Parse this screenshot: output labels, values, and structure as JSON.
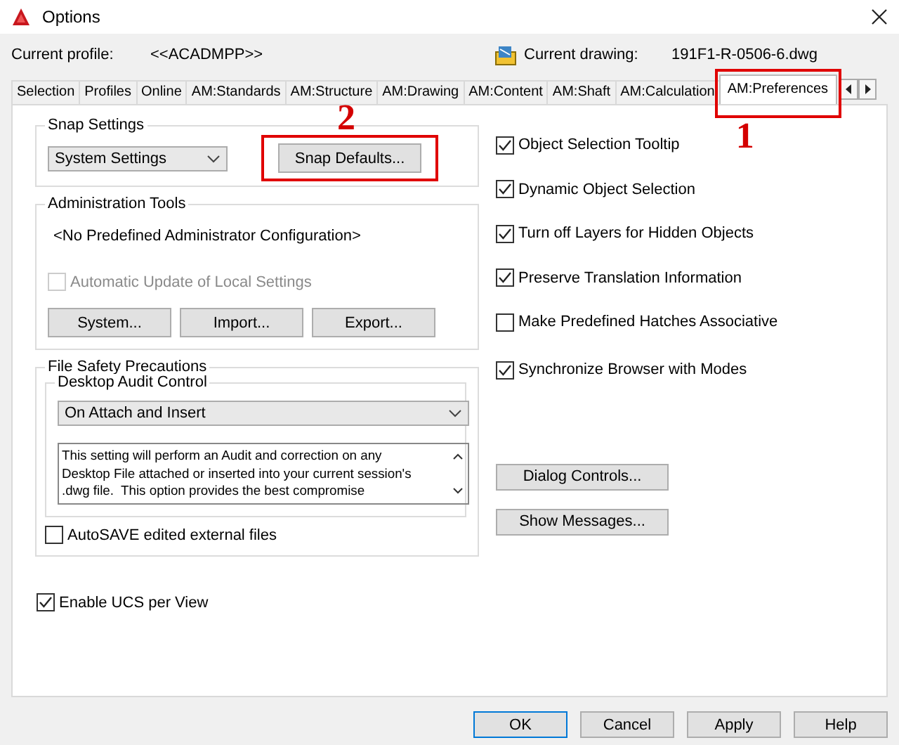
{
  "window": {
    "title": "Options"
  },
  "profile": {
    "label": "Current profile:",
    "value": "<<ACADMPP>>"
  },
  "drawing": {
    "label": "Current drawing:",
    "value": "191F1-R-0506-6.dwg"
  },
  "tabs": [
    {
      "label": "Selection",
      "selected": false
    },
    {
      "label": "Profiles",
      "selected": false
    },
    {
      "label": "Online",
      "selected": false
    },
    {
      "label": "AM:Standards",
      "selected": false
    },
    {
      "label": "AM:Structure",
      "selected": false
    },
    {
      "label": "AM:Drawing",
      "selected": false
    },
    {
      "label": "AM:Content",
      "selected": false
    },
    {
      "label": "AM:Shaft",
      "selected": false
    },
    {
      "label": "AM:Calculation",
      "selected": false
    },
    {
      "label": "AM:Preferences",
      "selected": true
    }
  ],
  "snap_settings": {
    "title": "Snap Settings",
    "dropdown": "System Settings",
    "button": "Snap Defaults..."
  },
  "administration_tools": {
    "title": "Administration Tools",
    "configuration": "<No Predefined Administrator Configuration>",
    "checkbox": {
      "label": "Automatic Update of Local Settings",
      "checked": false,
      "disabled": true
    },
    "buttons": [
      "System...",
      "Import...",
      "Export..."
    ]
  },
  "file_safety": {
    "title": "File Safety Precautions",
    "audit": {
      "title": "Desktop Audit Control",
      "dropdown": "On Attach and Insert",
      "description": "This setting will perform an Audit and correction on any\nDesktop File attached or inserted into your current session's\n.dwg file.  This option provides the best compromise"
    },
    "checkbox": {
      "label": "AutoSAVE edited external files",
      "checked": false
    }
  },
  "ucs_checkbox": {
    "label": "Enable UCS per View",
    "checked": true
  },
  "options": [
    {
      "label": "Object Selection Tooltip",
      "checked": true
    },
    {
      "label": "Dynamic Object Selection",
      "checked": true
    },
    {
      "label": "Turn off Layers for Hidden Objects",
      "checked": true
    },
    {
      "label": "Preserve Translation Information",
      "checked": true
    },
    {
      "label": "Make Predefined Hatches Associative",
      "checked": false
    },
    {
      "label": "Synchronize Browser with Modes",
      "checked": true
    }
  ],
  "side_buttons": [
    "Dialog Controls...",
    "Show Messages..."
  ],
  "annotations": [
    {
      "label": "1"
    },
    {
      "label": "2"
    }
  ],
  "buttons": [
    {
      "label": "OK",
      "default": true
    },
    {
      "label": "Cancel",
      "default": false
    },
    {
      "label": "Apply",
      "default": false
    },
    {
      "label": "Help",
      "default": false
    }
  ]
}
